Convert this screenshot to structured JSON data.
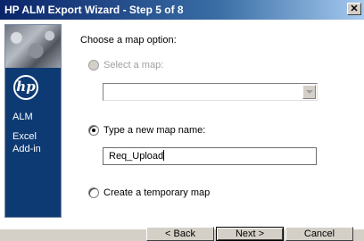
{
  "window": {
    "title": "HP ALM Export Wizard - Step 5 of 8",
    "close_symbol": "✕"
  },
  "sidebar": {
    "logo_text": "hp",
    "product_line1": "ALM",
    "product_line2": "Excel",
    "product_line3": "Add-in"
  },
  "form": {
    "prompt": "Choose a map option:",
    "option_select_label": "Select a map:",
    "option_select_checked": false,
    "option_select_enabled": false,
    "select_value": "",
    "option_new_label": "Type a new map name:",
    "option_new_checked": true,
    "new_map_value": "Req_Upload",
    "option_temp_label": "Create a temporary map",
    "option_temp_checked": false
  },
  "buttons": {
    "back_label": "< Back",
    "next_label": "Next >",
    "cancel_label": "Cancel"
  },
  "icons": {
    "close": "close-icon",
    "dropdown": "chevron-down-icon"
  }
}
